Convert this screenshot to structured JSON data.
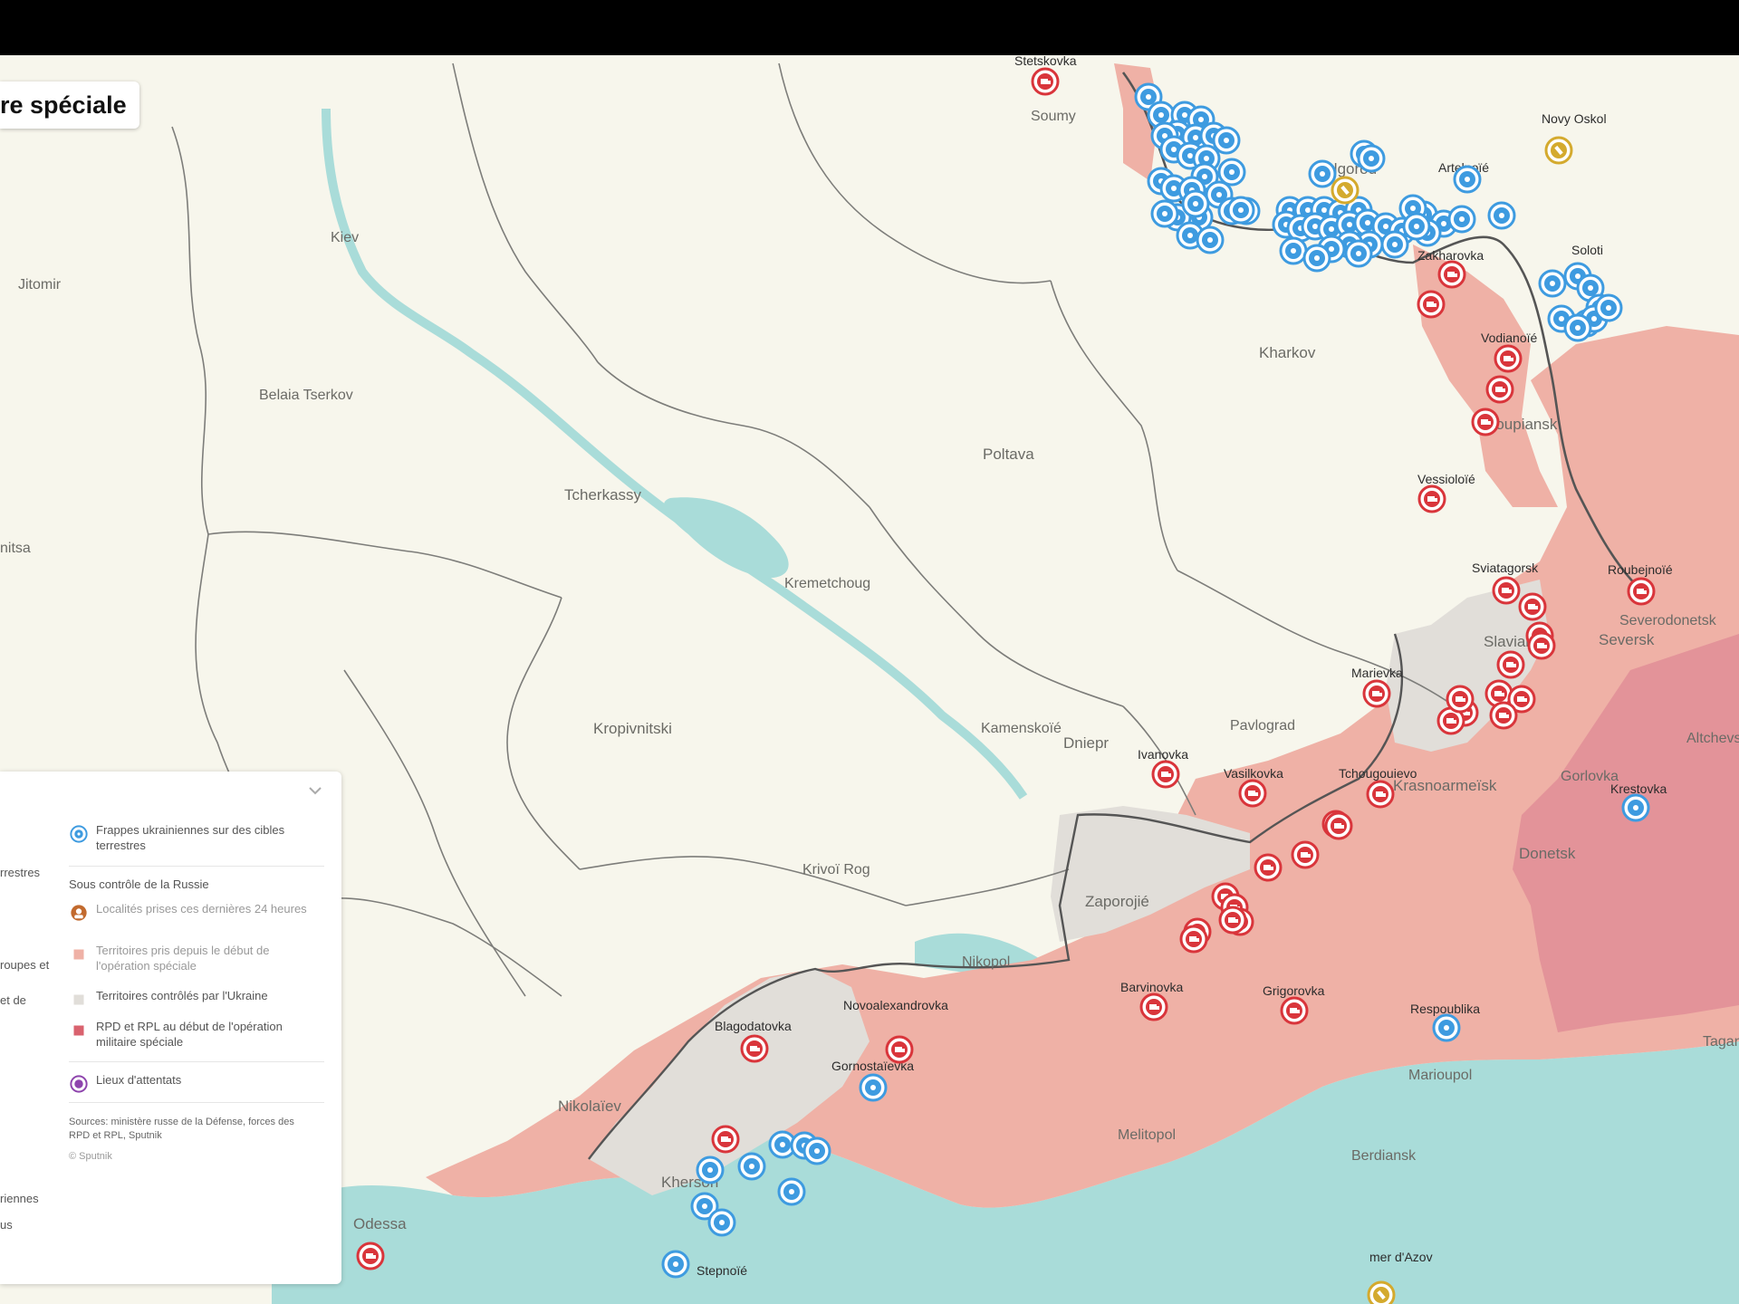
{
  "header": {
    "title": "re spéciale"
  },
  "legend": {
    "items": [
      {
        "icon": "ukraine-strike-icon",
        "label": "Frappes ukrainiennes sur des cibles terrestres"
      },
      {
        "icon": "captured-locality-icon",
        "label": "Localités prises ces dernières 24 heures"
      },
      {
        "icon": "territory-taken-swatch-icon",
        "label": "Territoires pris depuis le début de l'opération spéciale"
      },
      {
        "icon": "ukraine-control-swatch-icon",
        "label": "Territoires contrôlés par l'Ukraine"
      },
      {
        "icon": "dpr-lpr-swatch-icon",
        "label": "RPD et RPL au début de l'opération militaire spéciale"
      },
      {
        "icon": "attack-site-icon",
        "label": "Lieux d'attentats"
      }
    ],
    "russia_heading": "Sous contrôle de la Russie",
    "cut_labels": [
      "rrestres",
      "roupes et",
      "et de",
      "riennes",
      "us"
    ],
    "sources": "Sources: ministère russe de la Défense, forces des RPD et RPL, Sputnik",
    "copyright": "© Sputnik"
  },
  "colors": {
    "land": "#f7f6ec",
    "water": "#a9dcd9",
    "russia_controlled": "#efb1a6",
    "ukraine_controlled": "#e1ded9",
    "dpr_lpr": "#e39399",
    "ukraine_strike": "#3e9be0",
    "russian_capture": "#d9353b",
    "locality_taken": "#d4aa2e",
    "attack_site": "#8e44ad"
  },
  "places": [
    "Stetskovka",
    "Soumy",
    "Novy Oskol",
    "Belgorod",
    "Artelnoïé",
    "Zakharovka",
    "Soloti",
    "Kiev",
    "Jitomir",
    "Belaia Tserkov",
    "Kharkov",
    "Vodianoïé",
    "Koupiansk",
    "Poltava",
    "Tcherkassy",
    "Vessioloïé",
    "nitsa",
    "Kremetchoug",
    "Sviatagorsk",
    "Roubejnoïé",
    "Severodonetsk",
    "Slaviansk",
    "Seversk",
    "Marievka",
    "Kropivnitski",
    "Kamenskoïé",
    "Dniepr",
    "Pavlograd",
    "Ivanovka",
    "Vasilkovka",
    "Tchougouievo",
    "Krasnoarmeïsk",
    "Gorlovka",
    "Altchevsk",
    "Krestovka",
    "Donetsk",
    "Krivoï Rog",
    "Zaporojié",
    "Nikopol",
    "Barvinovka",
    "Grigorovka",
    "Respoublika",
    "Novoalexandrovka",
    "Blagodatovka",
    "Gornostaïevka",
    "Marioupol",
    "Tagan",
    "Nikolaïev",
    "Melitopol",
    "Berdiansk",
    "Kherson",
    "Odessa",
    "Stepnoïé",
    "mer d'Azov"
  ]
}
